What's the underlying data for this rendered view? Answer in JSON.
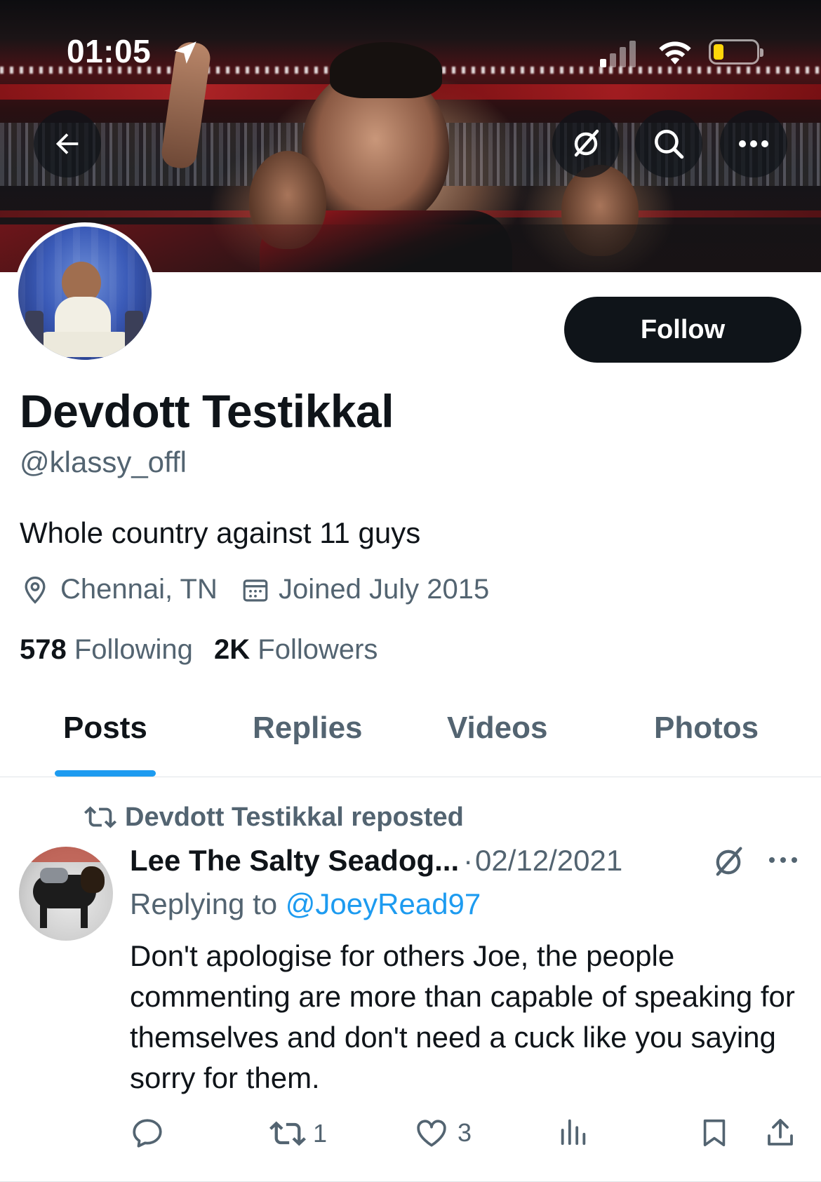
{
  "status_bar": {
    "time": "01:05"
  },
  "profile": {
    "display_name": "Devdott Testikkal",
    "handle": "@klassy_offl",
    "bio": "Whole country against 11 guys",
    "location": "Chennai, TN",
    "joined": "Joined July 2015",
    "following_count": "578",
    "following_label": "Following",
    "followers_count": "2K",
    "followers_label": "Followers",
    "follow_label": "Follow"
  },
  "tabs": [
    {
      "label": "Posts",
      "active": true
    },
    {
      "label": "Replies",
      "active": false
    },
    {
      "label": "Videos",
      "active": false
    },
    {
      "label": "Photos",
      "active": false
    }
  ],
  "post": {
    "repost_label": "Devdott Testikkal reposted",
    "author": "Lee The Salty Seadog...",
    "separator": "·",
    "date": "02/12/2021",
    "replying_prefix": "Replying to",
    "replying_to": "@JoeyRead97",
    "body": "Don't apologise for others Joe, the people commenting are more than capable of speaking for themselves and don't need a cuck like you saying sorry for them.",
    "retweets": "1",
    "likes": "3"
  },
  "icons": {
    "back": "arrow-left-icon",
    "grok": "grok-icon",
    "search": "search-icon",
    "more": "more-icon",
    "location": "location-pin-icon",
    "calendar": "calendar-icon",
    "repost": "repost-icon",
    "reply": "reply-icon",
    "like": "heart-icon",
    "views": "views-icon",
    "bookmark": "bookmark-icon",
    "share": "share-icon"
  },
  "colors": {
    "accent": "#1d9bf0",
    "text": "#0f1419",
    "secondary": "#536471",
    "button": "#0f1419"
  }
}
